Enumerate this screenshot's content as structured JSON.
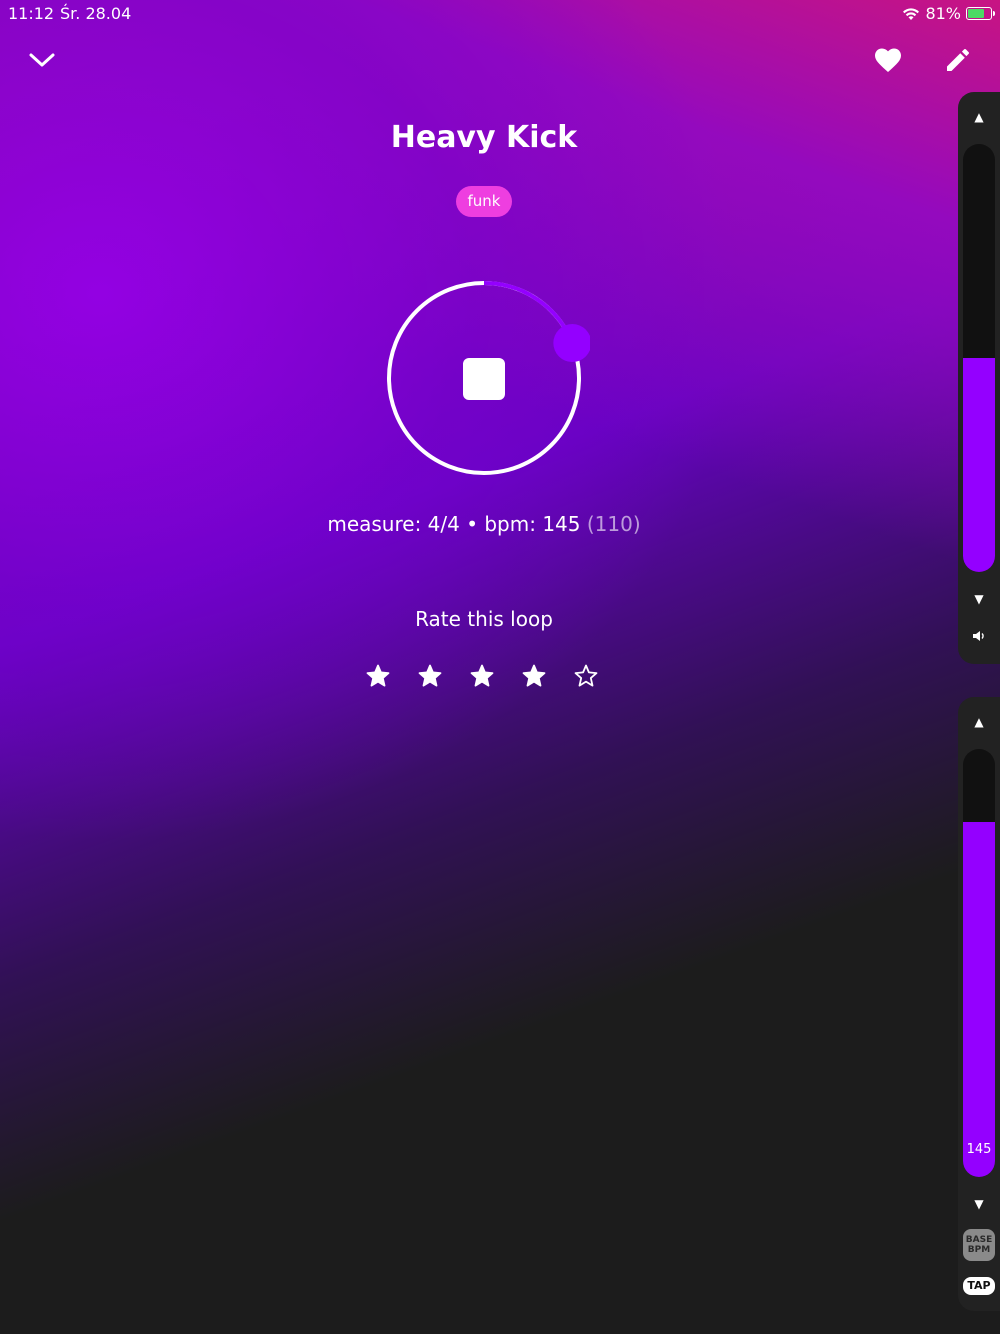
{
  "status_bar": {
    "time": "11:12",
    "date": "Śr. 28.04",
    "battery": "81%",
    "battery_level": 0.81
  },
  "header": {
    "collapse_icon": "chevron-down-icon",
    "favorite_icon": "heart-icon",
    "edit_icon": "pencil-icon"
  },
  "loop": {
    "title": "Heavy Kick",
    "tag": "funk",
    "play_icon": "stop-icon",
    "progress": 0.19,
    "info_prefix": "measure: 4/4 • bpm:  145",
    "info_base": "(110)"
  },
  "rating": {
    "label": "Rate this loop",
    "value": 4,
    "max": 5
  },
  "volume": {
    "level": 0.5,
    "up_icon": "arrow-up-icon",
    "down_icon": "arrow-down-icon",
    "speaker_icon": "speaker-icon"
  },
  "tempo": {
    "value": "145",
    "level": 0.83,
    "up_icon": "arrow-up-icon",
    "down_icon": "arrow-down-icon",
    "base_bpm_line1": "BASE",
    "base_bpm_line2": "BPM",
    "tap_label": "TAP"
  },
  "colors": {
    "accent": "#9400ff",
    "tag": "#ee3ee0",
    "background": "#1c1c1c",
    "battery": "#4cd964"
  }
}
